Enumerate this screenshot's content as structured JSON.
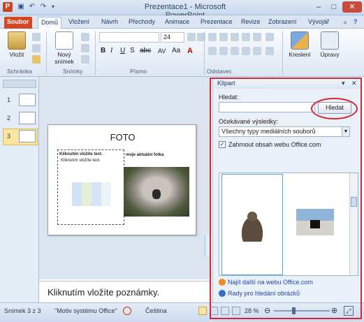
{
  "window": {
    "title": "Prezentace1 - Microsoft PowerPoint"
  },
  "tabs": [
    "Soubor",
    "Domů",
    "Vložení",
    "Návrh",
    "Přechody",
    "Animace",
    "Prezentace",
    "Revize",
    "Zobrazení",
    "Vývojář"
  ],
  "ribbon": {
    "clipboard": {
      "paste": "Vložit",
      "group": "Schránka"
    },
    "slides": {
      "new_slide_line1": "Nový",
      "new_slide_line2": "snímek",
      "group": "Snímky"
    },
    "font": {
      "size": "24",
      "group": "Písmo"
    },
    "paragraph": {
      "group": "Odstavec"
    },
    "drawing": {
      "shapes": "Kreslení",
      "edit": "Úpravy"
    }
  },
  "thumbnails": [
    "1",
    "2",
    "3"
  ],
  "slide": {
    "title": "FOTO",
    "left_heading": "Kliknutím vložíte text.",
    "left_bullet": "Kliknutím vložíte text.",
    "right_heading": "moje aktuální fotka"
  },
  "notes": {
    "placeholder": "Kliknutím vložíte poznámky."
  },
  "statusbar": {
    "slide_counter": "Snímek 3 z 3",
    "theme": "\"Motiv systému Office\"",
    "language": "Čeština",
    "zoom": "28 %"
  },
  "clipart": {
    "title": "Klipart",
    "search_label": "Hledat:",
    "search_value": "",
    "search_button": "Hledat",
    "results_label": "Očekávané výsledky:",
    "results_select": "Všechny typy mediálních souborů",
    "include_office_label": "Zahrnout obsah webu Office.com",
    "include_office_checked": true,
    "link_more": "Najít další na webu Office.com",
    "link_tips": "Rady pro hledání obrázků"
  },
  "colors": {
    "accent_red": "#d1283a",
    "file_tab": "#d24726",
    "ribbon_bg": "#dde7f3"
  }
}
